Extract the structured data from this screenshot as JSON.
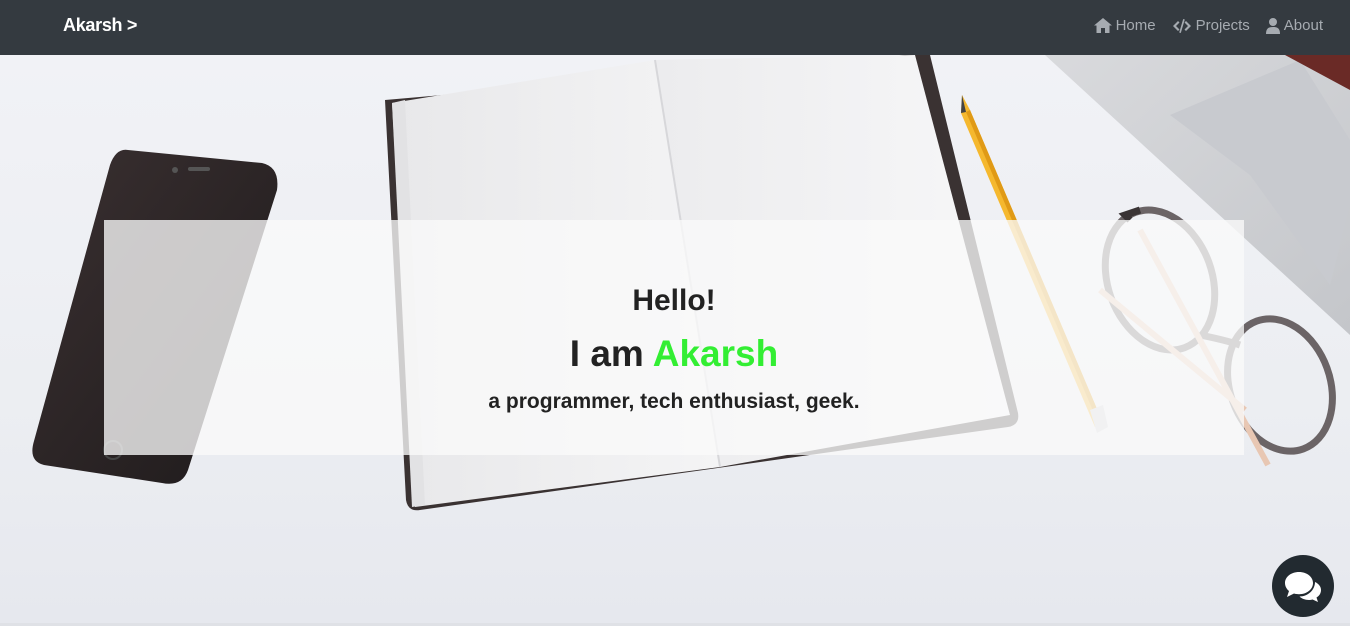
{
  "navbar": {
    "brand": "Akarsh >",
    "links": [
      {
        "label": "Home",
        "icon": "home-icon"
      },
      {
        "label": "Projects",
        "icon": "code-icon"
      },
      {
        "label": "About",
        "icon": "user-icon"
      }
    ]
  },
  "hero": {
    "greeting": "Hello!",
    "intro_prefix": "I am ",
    "name": "Akarsh",
    "tagline": "a programmer, tech enthusiast, geek."
  },
  "chat": {
    "icon": "chat-bubbles-icon"
  },
  "colors": {
    "navbar_bg": "#343a40",
    "name_accent": "#33ee33",
    "chat_bg": "#222a30"
  }
}
